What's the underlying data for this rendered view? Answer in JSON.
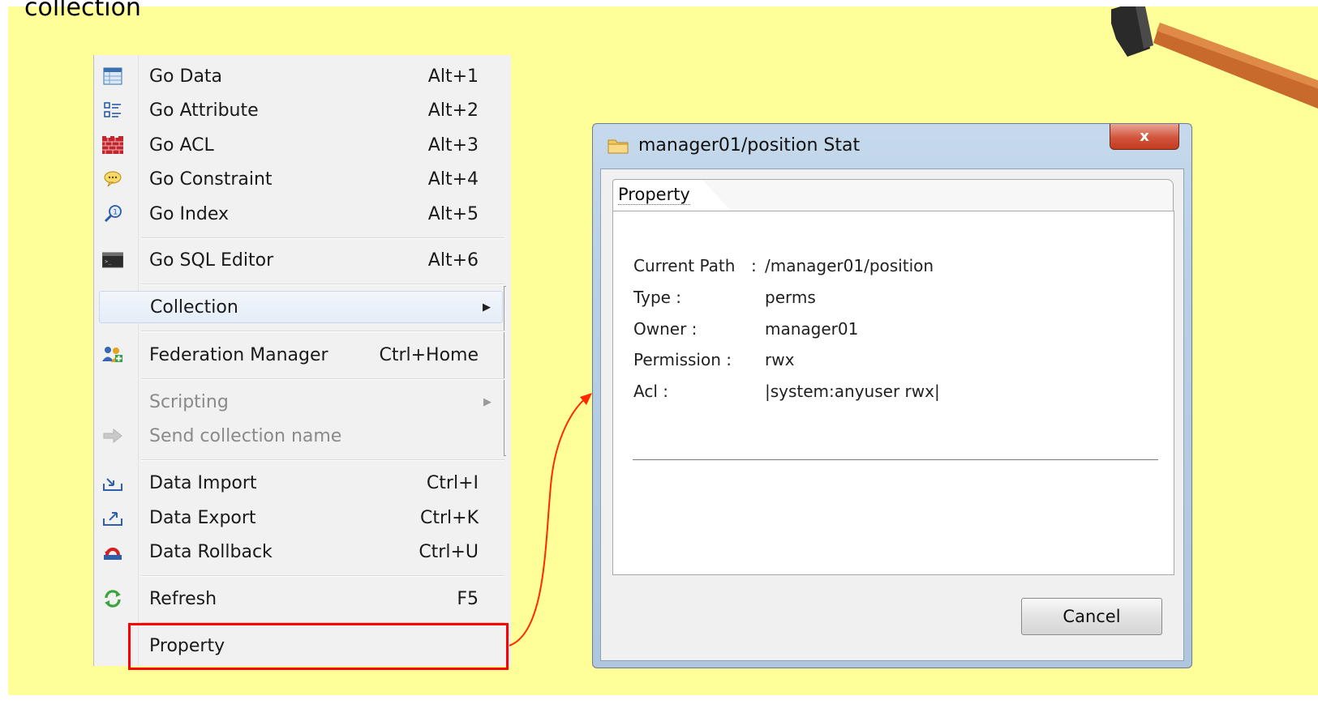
{
  "slide": {
    "heading": "collection",
    "background": "#ffff99",
    "highlight_color": "#ff0000"
  },
  "context_menu": {
    "items": [
      {
        "label": "Go Data",
        "shortcut": "Alt+1",
        "icon": "table-icon"
      },
      {
        "label": "Go Attribute",
        "shortcut": "Alt+2",
        "icon": "attribute-list-icon"
      },
      {
        "label": "Go ACL",
        "shortcut": "Alt+3",
        "icon": "brick-wall-icon"
      },
      {
        "label": "Go Constraint",
        "shortcut": "Alt+4",
        "icon": "speech-bubble-icon"
      },
      {
        "label": "Go Index",
        "shortcut": "Alt+5",
        "icon": "magnifier-icon"
      },
      {
        "label": "Go SQL Editor",
        "shortcut": "Alt+6",
        "icon": "terminal-icon"
      },
      {
        "label": "Collection",
        "shortcut": "",
        "icon": "",
        "submenu": true,
        "highlighted": true
      },
      {
        "label": "Federation Manager",
        "shortcut": "Ctrl+Home",
        "icon": "users-icon"
      },
      {
        "label": "Scripting",
        "shortcut": "",
        "icon": "",
        "submenu": true,
        "disabled": true
      },
      {
        "label": "Send collection name",
        "shortcut": "",
        "icon": "arrow-right-icon",
        "disabled": true
      },
      {
        "label": "Data Import",
        "shortcut": "Ctrl+I",
        "icon": "import-icon"
      },
      {
        "label": "Data Export",
        "shortcut": "Ctrl+K",
        "icon": "export-icon"
      },
      {
        "label": "Data Rollback",
        "shortcut": "Ctrl+U",
        "icon": "rollback-icon"
      },
      {
        "label": "Refresh",
        "shortcut": "F5",
        "icon": "refresh-icon"
      },
      {
        "label": "Property",
        "shortcut": "",
        "icon": ""
      }
    ]
  },
  "dialog": {
    "title": "manager01/position Stat",
    "close_label": "x",
    "tab_label": "Property",
    "properties": [
      {
        "label": "Current Path",
        "separator": ":",
        "value": "/manager01/position"
      },
      {
        "label": "Type :",
        "value": "perms"
      },
      {
        "label": "Owner :",
        "value": "manager01"
      },
      {
        "label": "Permission :",
        "value": "rwx"
      },
      {
        "label": "Acl :",
        "value": "|system:anyuser rwx|"
      }
    ],
    "cancel_label": "Cancel"
  }
}
